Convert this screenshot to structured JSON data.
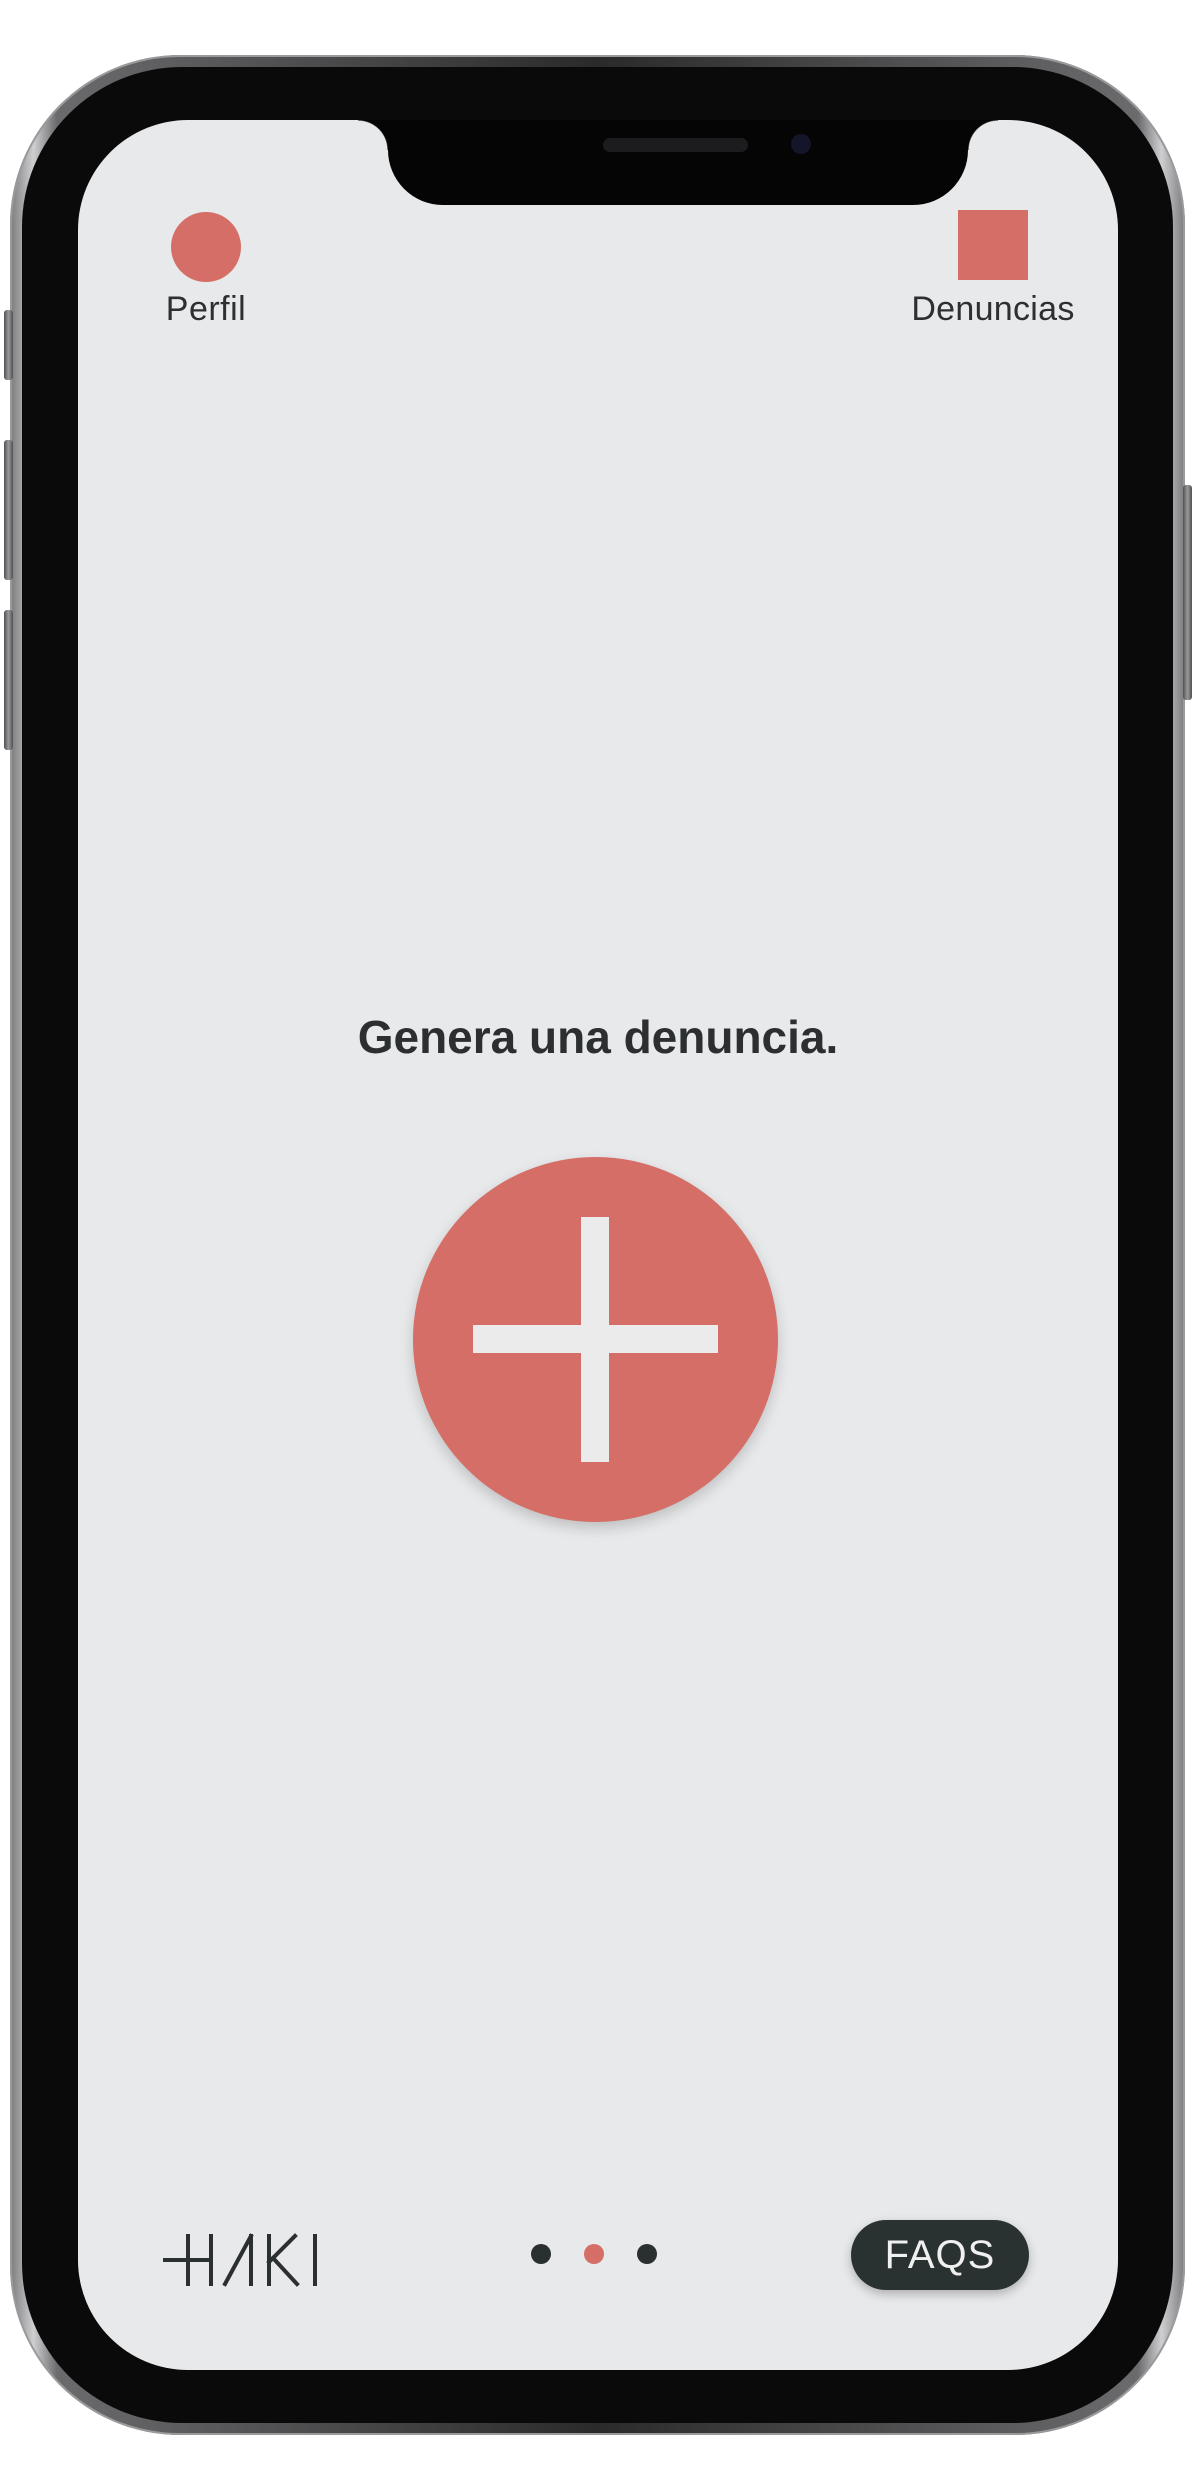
{
  "header": {
    "profile_label": "Perfil",
    "reports_label": "Denuncias"
  },
  "main": {
    "heading": "Genera una denuncia."
  },
  "footer": {
    "logo_text": "HAKI",
    "faqs_label": "FAQS",
    "pager": {
      "total": 3,
      "active_index": 1
    }
  },
  "colors": {
    "accent": "#d46e67",
    "background": "#e8e9eb",
    "dark": "#2a3231"
  },
  "icons": {
    "profile": "circle-icon",
    "reports": "square-icon",
    "add": "plus-icon"
  }
}
